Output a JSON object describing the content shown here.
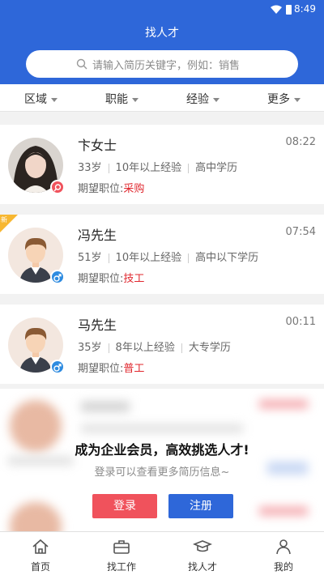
{
  "status": {
    "time": "8:49"
  },
  "header": {
    "title": "找人才"
  },
  "search": {
    "placeholder": "请输入简历关键字，例如：销售"
  },
  "filters": [
    {
      "label": "区域"
    },
    {
      "label": "职能"
    },
    {
      "label": "经验"
    },
    {
      "label": "更多"
    }
  ],
  "cards": [
    {
      "name": "卞女士",
      "time": "08:22",
      "age": "33岁",
      "exp": "10年以上经验",
      "edu": "高中学历",
      "job_label": "期望职位:",
      "job": "采购",
      "gender": "female",
      "new": false
    },
    {
      "name": "冯先生",
      "time": "07:54",
      "age": "51岁",
      "exp": "10年以上经验",
      "edu": "高中以下学历",
      "job_label": "期望职位:",
      "job": "技工",
      "gender": "male",
      "new": true,
      "new_label": "新"
    },
    {
      "name": "马先生",
      "time": "00:11",
      "age": "35岁",
      "exp": "8年以上经验",
      "edu": "大专学历",
      "job_label": "期望职位:",
      "job": "普工",
      "gender": "male",
      "new": false
    }
  ],
  "cta": {
    "title": "成为企业会员，高效挑选人才!",
    "subtitle": "登录可以查看更多简历信息~",
    "login": "登录",
    "register": "注册"
  },
  "tabbar": [
    {
      "label": "首页",
      "icon": "home-icon"
    },
    {
      "label": "找工作",
      "icon": "briefcase-icon"
    },
    {
      "label": "找人才",
      "icon": "graduation-cap-icon"
    },
    {
      "label": "我的",
      "icon": "user-icon"
    }
  ],
  "colors": {
    "brand": "#2e67d9",
    "accent": "#e0272e",
    "login": "#f0525c"
  }
}
